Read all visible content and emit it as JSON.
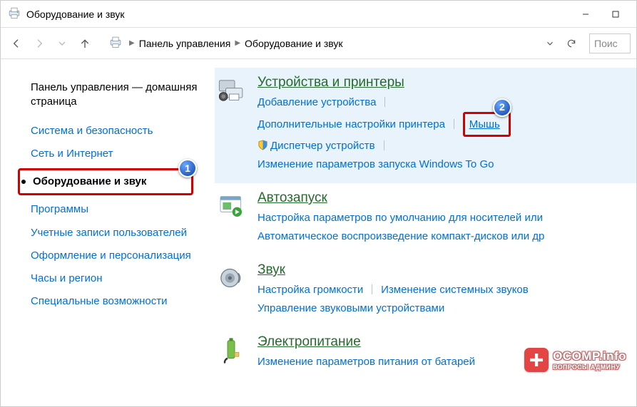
{
  "window": {
    "title": "Оборудование и звук"
  },
  "breadcrumb": {
    "root": "Панель управления",
    "current": "Оборудование и звук"
  },
  "search": {
    "placeholder": "Поис"
  },
  "badges": {
    "one": "1",
    "two": "2"
  },
  "sidebar": {
    "home": "Панель управления — домашняя страница",
    "items": [
      "Система и безопасность",
      "Сеть и Интернет",
      "Оборудование и звук",
      "Программы",
      "Учетные записи пользователей",
      "Оформление и персонализация",
      "Часы и регион",
      "Специальные возможности"
    ],
    "current_index": 2
  },
  "categories": [
    {
      "icon": "devices-printers-icon",
      "title": "Устройства и принтеры",
      "highlight": true,
      "links": [
        {
          "label": "Добавление устройства"
        },
        {
          "label": "Дополнительные настройки принтера"
        },
        {
          "label": "Мышь",
          "boxed": true
        },
        {
          "label": "Диспетчер устройств",
          "shield": true
        },
        {
          "label": "Изменение параметров запуска Windows To Go"
        }
      ]
    },
    {
      "icon": "autoplay-icon",
      "title": "Автозапуск",
      "links": [
        {
          "label": "Настройка параметров по умолчанию для носителей или"
        },
        {
          "label": "Автоматическое воспроизведение компакт-дисков или др"
        }
      ]
    },
    {
      "icon": "sound-icon",
      "title": "Звук",
      "links": [
        {
          "label": "Настройка громкости"
        },
        {
          "label": "Изменение системных звуков"
        },
        {
          "label": "Управление звуковыми устройствами"
        }
      ]
    },
    {
      "icon": "power-icon",
      "title": "Электропитание",
      "links": [
        {
          "label": "Изменение параметров питания от батарей"
        }
      ]
    }
  ],
  "watermark": {
    "line1": "OCOMP.info",
    "line2": "ВОПРОСЫ АДМИНУ"
  }
}
